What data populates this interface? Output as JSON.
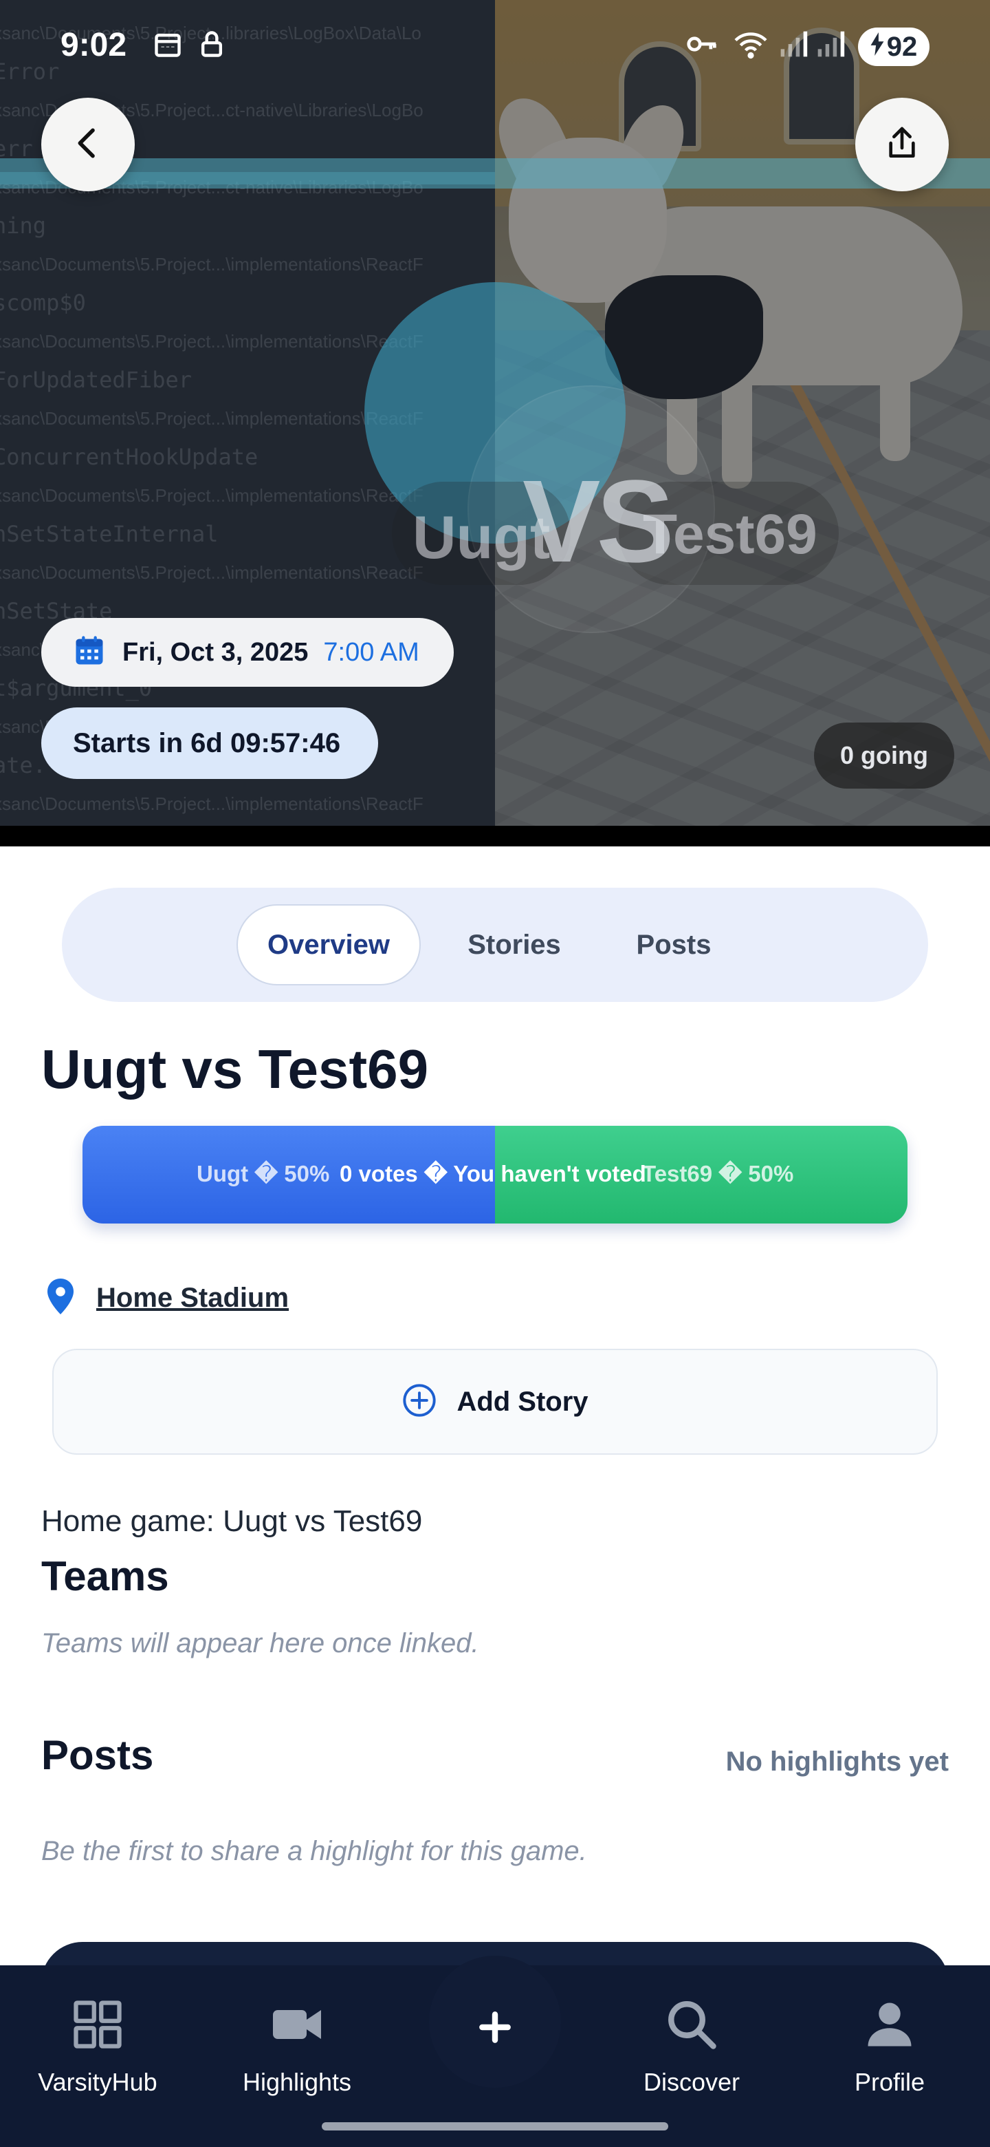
{
  "status_bar": {
    "time": "9:02",
    "battery": "92"
  },
  "hero": {
    "code_lines": [
      {
        "big": "xsanc\\Documents\\5.Project...libraries\\LogBox\\Data\\Lo",
        "small": true
      },
      {
        "big": "Error",
        "small": false
      },
      {
        "big": "xsanc\\Documents\\5.Project...ct-native\\Libraries\\LogBo",
        "small": true
      },
      {
        "big": "err",
        "small": false
      },
      {
        "big": "xsanc\\Documents\\5.Project...ct-native\\Libraries\\LogBo",
        "small": true
      },
      {
        "big": "ning",
        "small": false
      },
      {
        "big": "xsanc\\Documents\\5.Project...\\implementations\\ReactF",
        "small": true
      },
      {
        "big": "scomp$0",
        "small": false
      },
      {
        "big": "xsanc\\Documents\\5.Project...\\implementations\\ReactF",
        "small": true
      },
      {
        "big": "ForUpdatedFiber",
        "small": false
      },
      {
        "big": "xsanc\\Documents\\5.Project...\\implementations\\ReactF",
        "small": true
      },
      {
        "big": "ConcurrentHookUpdate",
        "small": false
      },
      {
        "big": "xsanc\\Documents\\5.Project...\\implementations\\ReactF",
        "small": true
      },
      {
        "big": "nSetStateInternal",
        "small": false
      },
      {
        "big": "xsanc\\Documents\\5.Project...\\implementations\\ReactF",
        "small": true
      },
      {
        "big": "nSetState",
        "small": false
      },
      {
        "big": "xsanc\\Documents\\5.Project...\\implementations\\ReactF",
        "small": true
      },
      {
        "big": "t$argument_0",
        "small": false
      },
      {
        "big": "xsanc\\Documents\\5.Project...\\eVerticalFee",
        "small": true
      },
      {
        "big": "ate.",
        "small": false
      },
      {
        "big": "xsanc\\Documents\\5.Project...\\implementations\\ReactF",
        "small": true
      }
    ],
    "vs": "VS",
    "team_left": "Uugt",
    "team_right": "Test69",
    "date": "Fri, Oct 3, 2025",
    "time": "7:00 AM",
    "countdown": "Starts in 6d 09:57:46",
    "going": "0 going"
  },
  "tabs": [
    {
      "label": "Overview",
      "active": true
    },
    {
      "label": "Stories",
      "active": false
    },
    {
      "label": "Posts",
      "active": false
    }
  ],
  "game": {
    "title": "Uugt vs Test69",
    "vote": {
      "left_label": "Uugt � 50%",
      "center_label": "0 votes � You haven't voted",
      "right_label": "Test69 � 50%",
      "left_share": 0.5,
      "left_color": "#2c64e5",
      "right_color": "#22b86f"
    },
    "location": "Home Stadium",
    "add_story": "Add Story",
    "description": "Home game: Uugt vs Test69"
  },
  "teams": {
    "heading": "Teams",
    "empty": "Teams will appear here once linked."
  },
  "posts": {
    "heading": "Posts",
    "status": "No highlights yet",
    "empty": "Be the first to share a highlight for this game."
  },
  "nav": [
    {
      "label": "VarsityHub",
      "icon": "grid-icon"
    },
    {
      "label": "Highlights",
      "icon": "video-camera-icon"
    },
    {
      "label": "",
      "icon": "plus-icon"
    },
    {
      "label": "Discover",
      "icon": "search-icon"
    },
    {
      "label": "Profile",
      "icon": "person-icon"
    }
  ]
}
